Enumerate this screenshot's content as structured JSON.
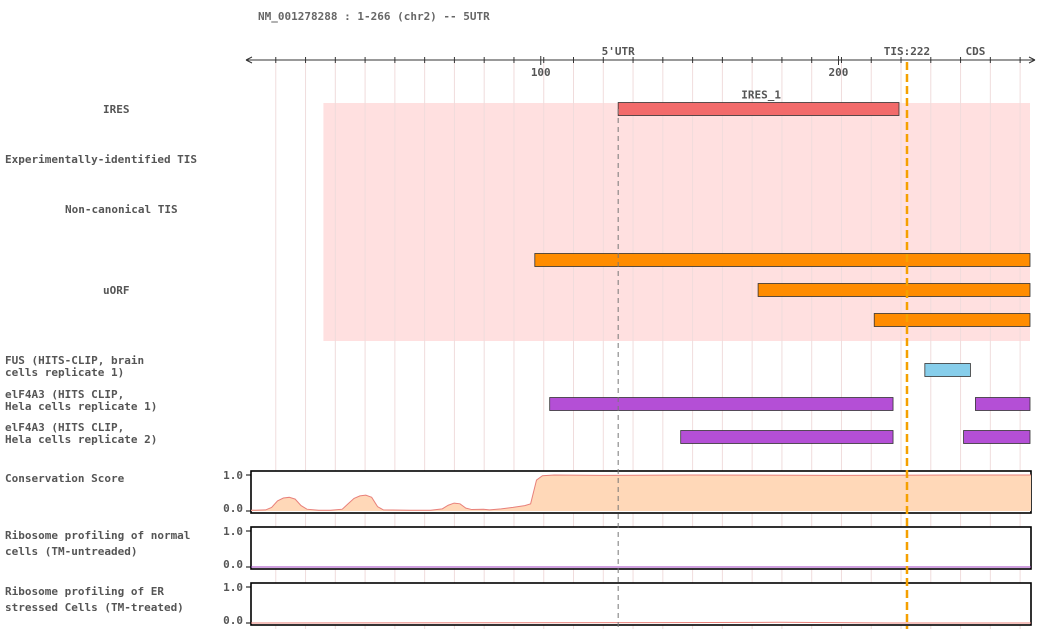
{
  "header": {
    "title": "NM_001278288 : 1-266 (chr2) -- 5UTR"
  },
  "chart_data": {
    "type": "genome-track",
    "x_range": [
      1,
      266
    ],
    "major_ticks": [
      {
        "pos": 100,
        "label": "100"
      },
      {
        "pos": 200,
        "label": "200"
      }
    ],
    "region_labels": [
      {
        "text": "5'UTR",
        "pos": 126,
        "color": "#dd0000"
      },
      {
        "text": "TIS:222",
        "pos": 223,
        "color": "#f5a000"
      },
      {
        "text": "CDS",
        "pos": 246,
        "color": "#229922"
      }
    ],
    "tis_position": 222,
    "ires_start_marker": 126,
    "shaded_region": {
      "start": 27,
      "end": 266,
      "color": "#ffe0e0"
    },
    "tracks": [
      {
        "label_lines": [
          "IRES"
        ],
        "features": [
          {
            "start": 126,
            "end": 222,
            "color": "#f26b6b",
            "name": "IRES_1"
          }
        ]
      },
      {
        "label_lines": [
          "Experimentally-identified TIS"
        ],
        "features": []
      },
      {
        "label_lines": [
          "Non-canonical TIS"
        ],
        "features": []
      },
      {
        "label_lines": [
          "uORF"
        ],
        "features": [
          {
            "start": 98,
            "end": 266,
            "color": "#ff8c00"
          },
          {
            "start": 173,
            "end": 266,
            "color": "#ff8c00"
          },
          {
            "start": 212,
            "end": 266,
            "color": "#ff8c00"
          }
        ]
      },
      {
        "label_lines": [
          "FUS (HITS-CLIP, brain",
          "cells replicate 1)"
        ],
        "features": [
          {
            "start": 229,
            "end": 246,
            "color": "#87ceeb"
          }
        ]
      },
      {
        "label_lines": [
          "elF4A3 (HITS CLIP,",
          "Hela cells replicate 1)"
        ],
        "features": [
          {
            "start": 103,
            "end": 220,
            "color": "#b44fd6"
          },
          {
            "start": 246,
            "end": 266,
            "color": "#b44fd6"
          }
        ]
      },
      {
        "label_lines": [
          "elF4A3 (HITS CLIP,",
          "Hela cells replicate 2)"
        ],
        "features": [
          {
            "start": 147,
            "end": 220,
            "color": "#b44fd6"
          },
          {
            "start": 242,
            "end": 266,
            "color": "#b44fd6"
          }
        ]
      }
    ],
    "signal_tracks": [
      {
        "label_lines": [
          "Conservation Score"
        ],
        "ylim": [
          0,
          1
        ],
        "ytick_labels": [
          "1.0",
          "0.0"
        ],
        "fill": "#ffd8b8",
        "stroke": "#e8807a",
        "points": [
          [
            1,
            0.02
          ],
          [
            6,
            0.03
          ],
          [
            8,
            0.1
          ],
          [
            10,
            0.28
          ],
          [
            12,
            0.36
          ],
          [
            14,
            0.38
          ],
          [
            16,
            0.33
          ],
          [
            18,
            0.15
          ],
          [
            20,
            0.05
          ],
          [
            24,
            0.02
          ],
          [
            28,
            0.02
          ],
          [
            32,
            0.05
          ],
          [
            34,
            0.2
          ],
          [
            36,
            0.35
          ],
          [
            38,
            0.42
          ],
          [
            40,
            0.44
          ],
          [
            42,
            0.38
          ],
          [
            44,
            0.12
          ],
          [
            46,
            0.03
          ],
          [
            55,
            0.02
          ],
          [
            62,
            0.02
          ],
          [
            66,
            0.06
          ],
          [
            68,
            0.16
          ],
          [
            70,
            0.22
          ],
          [
            72,
            0.2
          ],
          [
            74,
            0.08
          ],
          [
            76,
            0.04
          ],
          [
            80,
            0.05
          ],
          [
            82,
            0.03
          ],
          [
            86,
            0.06
          ],
          [
            90,
            0.1
          ],
          [
            94,
            0.15
          ],
          [
            96,
            0.2
          ],
          [
            98,
            0.86
          ],
          [
            100,
            0.98
          ],
          [
            104,
            1.0
          ],
          [
            120,
            0.99
          ],
          [
            150,
            1.0
          ],
          [
            200,
            0.99
          ],
          [
            240,
            1.0
          ],
          [
            266,
            1.0
          ]
        ]
      },
      {
        "label_lines": [
          "Ribosome profiling of normal",
          "cells (TM-untreaded)"
        ],
        "ylim": [
          0,
          1
        ],
        "ytick_labels": [
          "1.0",
          "0.0"
        ],
        "fill": "none",
        "stroke": "#a040c0",
        "points": [
          [
            1,
            0.0
          ],
          [
            266,
            0.0
          ]
        ]
      },
      {
        "label_lines": [
          "Ribosome profiling of ER",
          "stressed Cells (TM-treated)"
        ],
        "ylim": [
          0,
          1
        ],
        "ytick_labels": [
          "1.0",
          "0.0"
        ],
        "fill": "none",
        "stroke": "#e8807a",
        "points": [
          [
            1,
            0.0
          ],
          [
            140,
            0.01
          ],
          [
            180,
            0.02
          ],
          [
            220,
            0.0
          ],
          [
            266,
            0.0
          ]
        ]
      }
    ]
  }
}
